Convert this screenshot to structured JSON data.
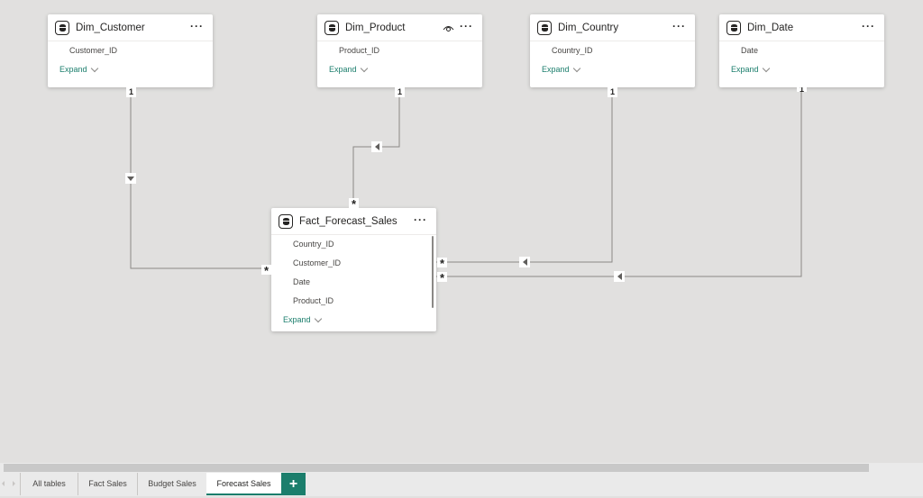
{
  "tables": {
    "dim_customer": {
      "title": "Dim_Customer",
      "fields": [
        "Customer_ID"
      ],
      "expand_label": "Expand",
      "more_label": "···"
    },
    "dim_product": {
      "title": "Dim_Product",
      "fields": [
        "Product_ID"
      ],
      "expand_label": "Expand",
      "more_label": "···"
    },
    "dim_country": {
      "title": "Dim_Country",
      "fields": [
        "Country_ID"
      ],
      "expand_label": "Expand",
      "more_label": "···"
    },
    "dim_date": {
      "title": "Dim_Date",
      "fields": [
        "Date"
      ],
      "expand_label": "Expand",
      "more_label": "···"
    },
    "fact_forecast_sales": {
      "title": "Fact_Forecast_Sales",
      "fields": [
        "Country_ID",
        "Customer_ID",
        "Date",
        "Product_ID"
      ],
      "expand_label": "Expand",
      "more_label": "···"
    }
  },
  "relationships": [
    {
      "from": "Dim_Customer",
      "to": "Fact_Forecast_Sales",
      "one_label": "1",
      "many_label": "*",
      "filter_direction": "down"
    },
    {
      "from": "Dim_Product",
      "to": "Fact_Forecast_Sales",
      "one_label": "1",
      "many_label": "*",
      "filter_direction": "left"
    },
    {
      "from": "Dim_Country",
      "to": "Fact_Forecast_Sales",
      "one_label": "1",
      "many_label": "*",
      "filter_direction": "left"
    },
    {
      "from": "Dim_Date",
      "to": "Fact_Forecast_Sales",
      "one_label": "1",
      "many_label": "*",
      "filter_direction": "left"
    }
  ],
  "tabs": [
    {
      "label": "All tables",
      "active": false
    },
    {
      "label": "Fact Sales",
      "active": false
    },
    {
      "label": "Budget Sales",
      "active": false
    },
    {
      "label": "Forecast Sales",
      "active": true
    }
  ],
  "add_tab_label": "+",
  "colors": {
    "accent": "#1b7e6c",
    "canvas": "#e1e0df",
    "line": "#8a8886"
  }
}
